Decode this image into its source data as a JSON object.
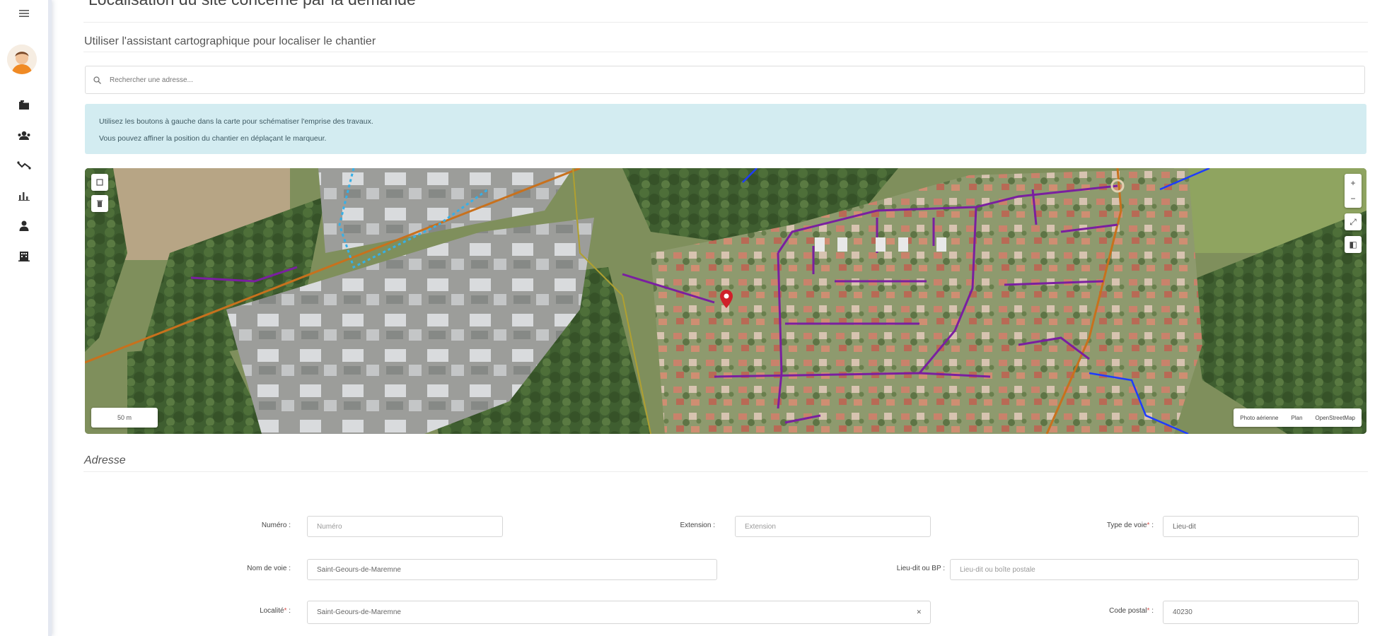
{
  "sidebar": {
    "items": [
      {
        "name": "menu-icon"
      },
      {
        "name": "folders-icon"
      },
      {
        "name": "users-icon"
      },
      {
        "name": "routes-icon"
      },
      {
        "name": "stats-icon"
      },
      {
        "name": "person-icon"
      },
      {
        "name": "building-icon"
      }
    ]
  },
  "header": {
    "title": "Localisation du site concerné par la demande",
    "map_assistant": "Utiliser l'assistant cartographique pour localiser le chantier"
  },
  "search": {
    "placeholder": "Rechercher une adresse..."
  },
  "alert": {
    "line1": "Utilisez les boutons à gauche dans la carte pour schématiser l'emprise des travaux.",
    "line2": "Vous pouvez affiner la position du chantier en déplaçant le marqueur."
  },
  "map": {
    "scale_label": "50 m",
    "layers": [
      "Photo aérienne",
      "Plan",
      "OpenStreetMap"
    ],
    "zoom_in": "+",
    "zoom_out": "−",
    "fullscreen": "⤢",
    "layers_icon": "◧"
  },
  "address": {
    "section_title": "Adresse",
    "numero": {
      "label": "Numéro :",
      "placeholder": "Numéro",
      "value": ""
    },
    "extension": {
      "label": "Extension :",
      "placeholder": "Extension",
      "value": ""
    },
    "type_voie": {
      "label": "Type de voie",
      "required": "*",
      "suffix": " :",
      "placeholder": "",
      "value": "Lieu-dit"
    },
    "nom_voie": {
      "label": "Nom de voie :",
      "placeholder": "",
      "value": "Saint-Geours-de-Maremne"
    },
    "lieu_dit": {
      "label": "Lieu-dit ou BP :",
      "placeholder": "Lieu-dit ou boîte postale",
      "value": ""
    },
    "localite": {
      "label": "Localité",
      "required": "*",
      "suffix": " :",
      "value": "Saint-Geours-de-Maremne"
    },
    "code_postal": {
      "label": "Code postal",
      "required": "*",
      "suffix": " :",
      "value": "40230"
    }
  },
  "colors": {
    "alert_bg": "#d3ecf1",
    "marker": "#d0202a",
    "network_purple": "#7a1fa0",
    "network_blue": "#1e3cff",
    "road_orange": "#c8711d"
  }
}
